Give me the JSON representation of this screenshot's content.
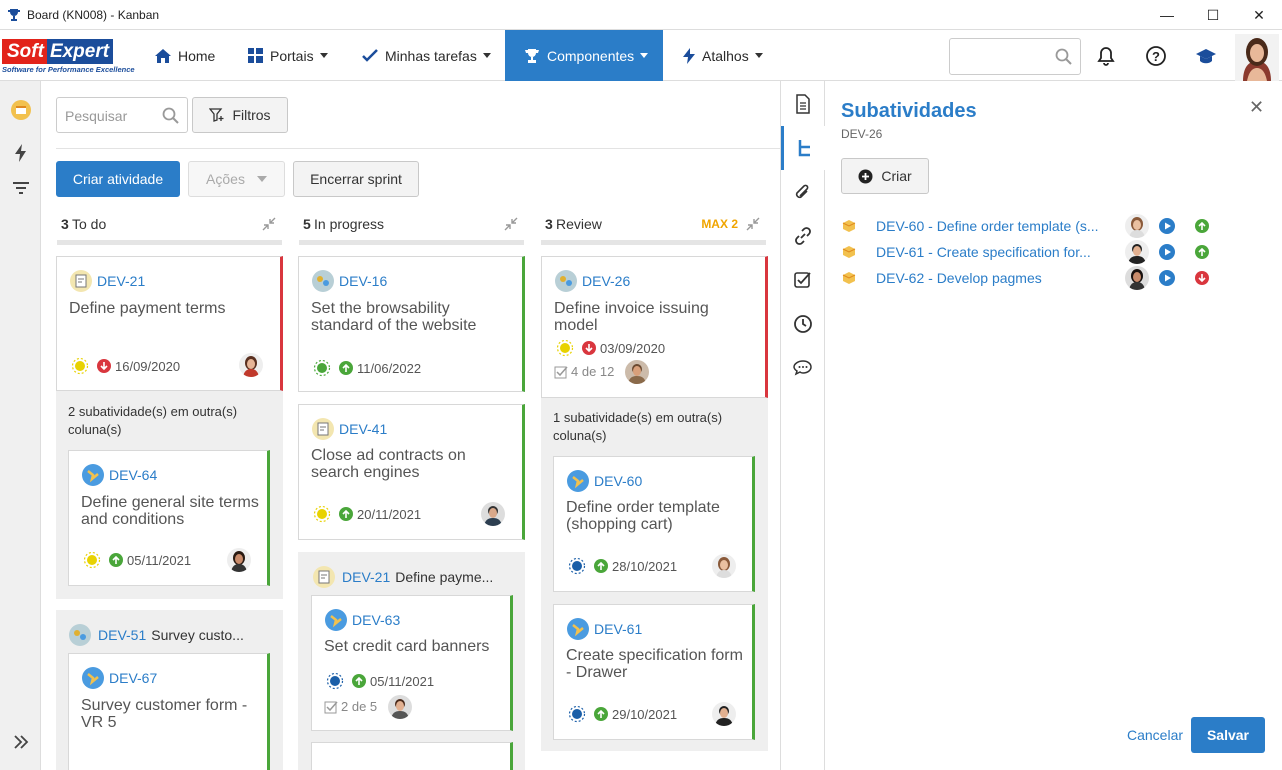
{
  "window": {
    "title": "Board (KN008) - Kanban"
  },
  "logo": {
    "soft": "Soft",
    "expert": "Expert",
    "tagline": "Software for Performance Excellence"
  },
  "nav": {
    "home": "Home",
    "portais": "Portais",
    "minhas": "Minhas tarefas",
    "componentes": "Componentes",
    "atalhos": "Atalhos"
  },
  "toolbar": {
    "search_placeholder": "Pesquisar",
    "filtros": "Filtros",
    "criar_atividade": "Criar atividade",
    "acoes": "Ações",
    "encerrar_sprint": "Encerrar sprint"
  },
  "columns": {
    "todo": {
      "count": "3",
      "name": "To do"
    },
    "inprogress": {
      "count": "5",
      "name": "In progress"
    },
    "review": {
      "count": "3",
      "name": "Review",
      "max": "MAX 2"
    }
  },
  "cards": {
    "dev21": {
      "id": "DEV-21",
      "title": "Define payment terms",
      "date": "16/09/2020"
    },
    "todo_note": "2 subatividade(s) em outra(s) coluna(s)",
    "dev64": {
      "id": "DEV-64",
      "title": "Define general site terms and conditions",
      "date": "05/11/2021"
    },
    "dev51": {
      "id": "DEV-51",
      "title": "Survey custo..."
    },
    "dev67": {
      "id": "DEV-67",
      "title": "Survey customer form - VR 5"
    },
    "dev16": {
      "id": "DEV-16",
      "title": "Set the browsability standard of the website",
      "date": "11/06/2022"
    },
    "dev41": {
      "id": "DEV-41",
      "title": "Close ad contracts on search engines",
      "date": "20/11/2021"
    },
    "dev21g": {
      "id": "DEV-21",
      "title": "Define payme..."
    },
    "dev63": {
      "id": "DEV-63",
      "title": "Set credit card banners",
      "date": "05/11/2021",
      "check": "2 de 5"
    },
    "dev26": {
      "id": "DEV-26",
      "title": "Define invoice issuing model",
      "date": "03/09/2020",
      "check": "4 de 12"
    },
    "review_note": "1 subatividade(s) em outra(s) coluna(s)",
    "dev60": {
      "id": "DEV-60",
      "title": "Define order template (shopping cart)",
      "date": "28/10/2021"
    },
    "dev61": {
      "id": "DEV-61",
      "title": "Create specification form - Drawer",
      "date": "29/10/2021"
    }
  },
  "panel": {
    "title": "Subatividades",
    "subtitle": "DEV-26",
    "criar": "Criar",
    "items": [
      {
        "label": "DEV-60 - Define order template (s...",
        "priority": "up"
      },
      {
        "label": "DEV-61 - Create specification for...",
        "priority": "up"
      },
      {
        "label": "DEV-62 - Develop pagmes",
        "priority": "down"
      }
    ],
    "cancelar": "Cancelar",
    "salvar": "Salvar"
  },
  "colors": {
    "accent": "#2b7dc8",
    "green": "#4aa63a",
    "red": "#d9363e",
    "yellow": "#e8d200",
    "max": "#f0a500"
  }
}
